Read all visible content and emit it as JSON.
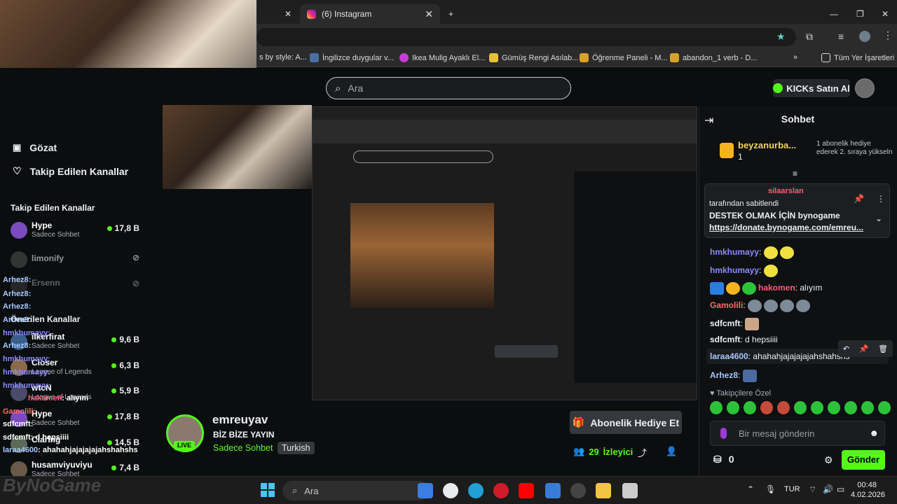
{
  "browser": {
    "tabs": [
      {
        "label": "(6) Instagram",
        "active": true
      }
    ],
    "new_tab_icon": "plus-icon",
    "bookmarks": [
      {
        "label": "s by style: A...",
        "color": "#a5a5a5"
      },
      {
        "label": "İngilizce duygular v...",
        "color": "#4b6fa5"
      },
      {
        "label": "Ikea Mulig Ayaklı El...",
        "color": "#c93bd6"
      },
      {
        "label": "Gümüş Rengi Asılab...",
        "color": "#e7c13a"
      },
      {
        "label": "Öğrenme Paneli - M...",
        "color": "#d9a12b"
      },
      {
        "label": "abandon_1 verb - D...",
        "color": "#d9a12b"
      }
    ],
    "more_bookmarks": "»",
    "all_bookmarks": "Tüm Yer İşaretleri"
  },
  "header": {
    "search_placeholder": "Ara",
    "kicks_button": "KICKs Satın Al"
  },
  "sidebar": {
    "browse": "Gözat",
    "following": "Takip Edilen Kanallar",
    "section_title": "Takip Edilen Kanallar",
    "channels": [
      {
        "name": "Hype",
        "sub": "Sadece Sohbet",
        "viewers": "17,8 B"
      },
      {
        "name": "limonify",
        "sub": "",
        "viewers": ""
      },
      {
        "name": "Ersenn",
        "sub": "",
        "viewers": ""
      },
      {
        "name": "Önerilen Kanallar",
        "sub": "",
        "viewers": ""
      },
      {
        "name": "ilkerfirat",
        "sub": "Sadece Sohbet",
        "viewers": "9,6 B"
      },
      {
        "name": "Closer",
        "sub": "League of Legends",
        "viewers": "6,3 B"
      },
      {
        "name": "wtcN",
        "sub": "League of Legends",
        "viewers": "5,9 B"
      },
      {
        "name": "Hype",
        "sub": "Sadece Sohbet",
        "viewers": "17,8 B"
      },
      {
        "name": "Claring",
        "sub": "",
        "viewers": "14,5 B"
      },
      {
        "name": "husamviyuviyu",
        "sub": "Sadece Sohbet",
        "viewers": "7,4 B"
      }
    ]
  },
  "overlay_chat": [
    {
      "user": "Arhez8",
      "text": ":"
    },
    {
      "user": "Arhez8",
      "text": ":"
    },
    {
      "user": "Arhez8",
      "text": ":"
    },
    {
      "user": "Arhez8",
      "text": ":"
    },
    {
      "user": "hmkhumayy",
      "text": ":"
    },
    {
      "user": "Arhez8",
      "text": ":"
    },
    {
      "user": "hmkhumayy",
      "text": ":"
    },
    {
      "user": "hmkhumayy",
      "text": ":"
    },
    {
      "user": "hmkhumayy",
      "text": ":"
    },
    {
      "user": "hakomen",
      "text": ": alıyım"
    },
    {
      "user": "Gamolili",
      "text": ":"
    },
    {
      "user": "sdfcmft",
      "text": ":"
    },
    {
      "user": "sdfcmft",
      "text": ": d hepsiiii"
    },
    {
      "user": "laraa4600",
      "text": ": ahahahjajajajajahshahshs"
    }
  ],
  "stream": {
    "streamer": "emreuyav",
    "title": "BİZ BİZE YAYIN",
    "category": "Sadece Sohbet",
    "language": "Turkish",
    "live_badge": "LIVE",
    "sub_gift_button": "Abonelik Hediye Et",
    "viewers_count": "29",
    "viewers_label": "İzleyici"
  },
  "chat": {
    "title": "Sohbet",
    "leader": {
      "name": "beyzanurba...",
      "count": "1",
      "rank_text": "1 abonelik hediye ederek 2. sıraya yükseln"
    },
    "pinned": {
      "author": "silaarslan",
      "by_text": "tarafından sabitlendi",
      "message": "DESTEK OLMAK İÇİN bynogame",
      "link": "https://donate.bynogame.com/emreu..."
    },
    "messages": [
      {
        "user": "Arhez8",
        "text": ":",
        "color": "#a6c7ff"
      },
      {
        "user": "hmkhumayy",
        "text": ":",
        "color": "#8b8bff"
      },
      {
        "user": "hmkhumayy",
        "text": ":",
        "color": "#8b8bff"
      },
      {
        "user": "hakomen",
        "text": ": alıyım",
        "color": "#ff5a7a"
      },
      {
        "user": "Gamolili",
        "text": ":",
        "color": "#ff6b6b"
      },
      {
        "user": "sdfcmft",
        "text": ":",
        "color": "#e8e8e8"
      },
      {
        "user": "sdfcmft",
        "text": ": d hepsiiii",
        "color": "#e8e8e8"
      },
      {
        "user": "laraa4600",
        "text": ": ahahahjajajajajahshahshs",
        "color": "#a6c7ff"
      },
      {
        "user": "Arhez8",
        "text": ":",
        "color": "#a6c7ff"
      }
    ],
    "followers_only": "Takipçilere Özel",
    "input_placeholder": "Bir mesaj gönderin",
    "points": "0",
    "send_button": "Gönder"
  },
  "taskbar": {
    "search_placeholder": "Ara",
    "lang": "TUR",
    "time": "00:48",
    "date": "4.02.2026"
  },
  "watermark": "ByNoGame"
}
